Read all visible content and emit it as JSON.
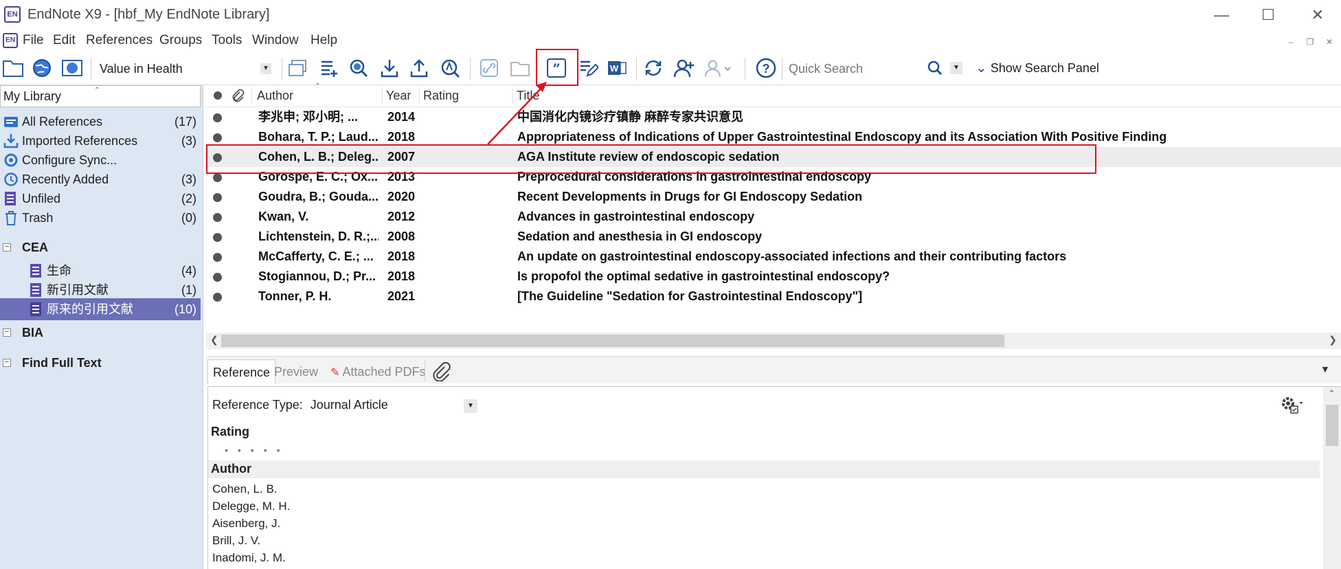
{
  "window": {
    "app_icon": "EN",
    "title": "EndNote X9 - [hbf_My EndNote Library]"
  },
  "menu": {
    "items": [
      "File",
      "Edit",
      "References",
      "Groups",
      "Tools",
      "Window",
      "Help"
    ]
  },
  "toolbar": {
    "style_value": "Value in Health",
    "quick_search_placeholder": "Quick Search",
    "show_search_panel": "Show Search Panel"
  },
  "sidebar": {
    "header": "My Library",
    "items": [
      {
        "label": "All References",
        "count": "(17)",
        "icon": "all-references-icon"
      },
      {
        "label": "Imported References",
        "count": "(3)",
        "icon": "import-icon"
      },
      {
        "label": "Configure Sync...",
        "count": "",
        "icon": "sync-icon"
      },
      {
        "label": "Recently Added",
        "count": "(3)",
        "icon": "clock-icon"
      },
      {
        "label": "Unfiled",
        "count": "(2)",
        "icon": "group-icon"
      },
      {
        "label": "Trash",
        "count": "(0)",
        "icon": "trash-icon"
      }
    ],
    "groups": [
      {
        "label": "CEA",
        "children": [
          {
            "label": "生命",
            "count": "(4)"
          },
          {
            "label": "新引用文献",
            "count": "(1)"
          },
          {
            "label": "原来的引用文献",
            "count": "(10)"
          }
        ]
      },
      {
        "label": "BIA"
      },
      {
        "label": "Find Full Text"
      }
    ]
  },
  "reflist": {
    "columns": {
      "author": "Author",
      "year": "Year",
      "rating": "Rating",
      "title": "Title"
    },
    "rows": [
      {
        "author": "李兆申; 邓小明; ...",
        "year": "2014",
        "title": "中国消化内镜诊疗镇静 麻醉专家共识意见"
      },
      {
        "author": "Bohara, T. P.; Laud...",
        "year": "2018",
        "title": "Appropriateness of Indications of Upper Gastrointestinal Endoscopy and its Association With Positive Finding"
      },
      {
        "author": "Cohen, L. B.; Deleg...",
        "year": "2007",
        "title": "AGA Institute review of endoscopic sedation"
      },
      {
        "author": "Gorospe, E. C.; Ox...",
        "year": "2013",
        "title": "Preprocedural considerations in gastrointestinal endoscopy"
      },
      {
        "author": "Goudra, B.; Gouda...",
        "year": "2020",
        "title": "Recent Developments in Drugs for GI Endoscopy Sedation"
      },
      {
        "author": "Kwan, V.",
        "year": "2012",
        "title": "Advances in gastrointestinal endoscopy"
      },
      {
        "author": "Lichtenstein, D. R.;...",
        "year": "2008",
        "title": "Sedation and anesthesia in GI endoscopy"
      },
      {
        "author": "McCafferty, C. E.; ...",
        "year": "2018",
        "title": "An update on gastrointestinal endoscopy-associated infections and their contributing factors"
      },
      {
        "author": "Stogiannou, D.; Pr...",
        "year": "2018",
        "title": "Is propofol the optimal sedative in gastrointestinal endoscopy?"
      },
      {
        "author": "Tonner, P. H.",
        "year": "2021",
        "title": "[The Guideline \"Sedation for Gastrointestinal Endoscopy\"]"
      }
    ]
  },
  "tabs": {
    "reference": "Reference",
    "preview": "Preview",
    "attached_pdfs": "Attached PDFs"
  },
  "panel": {
    "reference_type_label": "Reference Type:",
    "reference_type_value": "Journal Article",
    "rating_label": "Rating",
    "author_label": "Author",
    "authors": [
      "Cohen, L. B.",
      "Delegge, M. H.",
      "Aisenberg, J.",
      "Brill, J. V.",
      "Inadomi, J. M."
    ]
  },
  "colors": {
    "annotation_red": "#e0101e",
    "sidebar_bg": "#dde6f3",
    "selected_group": "#6b6fb7"
  }
}
